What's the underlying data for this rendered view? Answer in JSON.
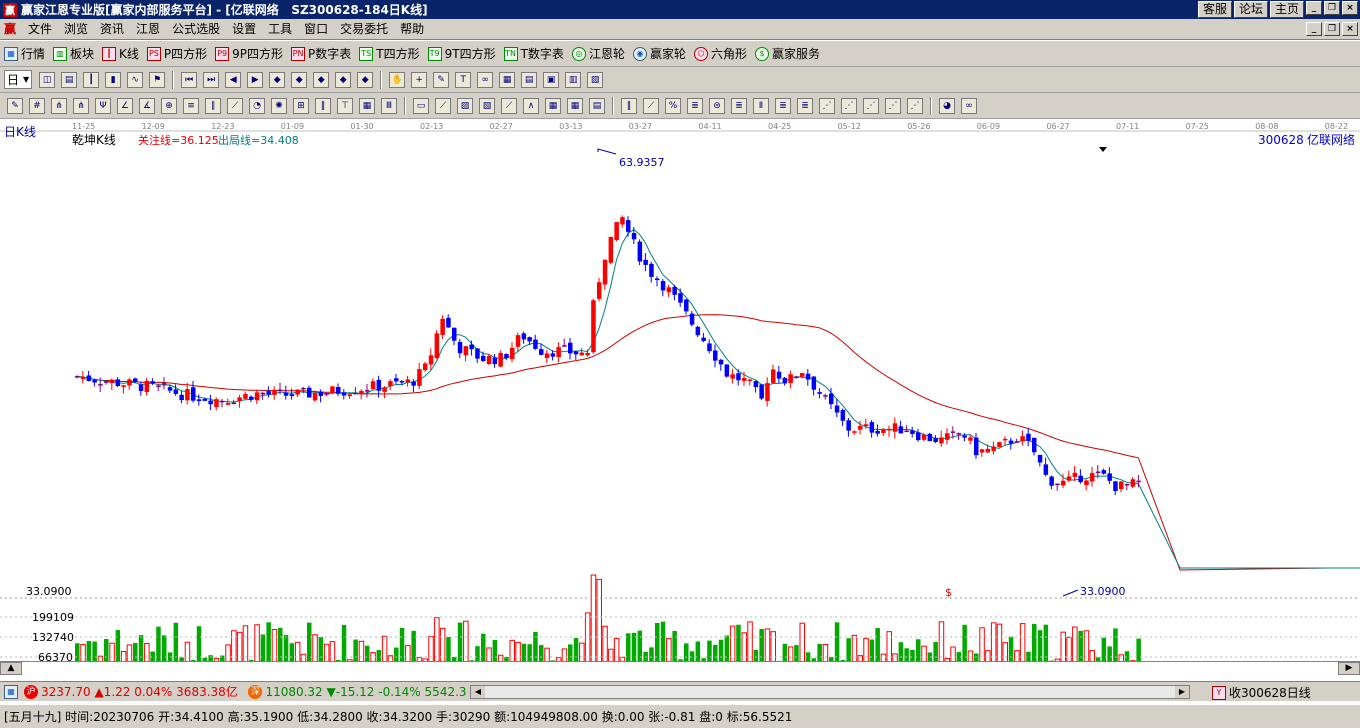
{
  "window": {
    "title": "赢家江恩专业版[赢家内部服务平台] - [亿联网络   SZ300628-184日K线]",
    "links": [
      "客服",
      "论坛",
      "主页"
    ]
  },
  "menu": [
    "文件",
    "浏览",
    "资讯",
    "江恩",
    "公式选股",
    "设置",
    "工具",
    "窗口",
    "交易委托",
    "帮助"
  ],
  "toolbar1": [
    {
      "label": "行情",
      "icon": "table-icon"
    },
    {
      "label": "板块",
      "icon": "sector-icon"
    },
    {
      "label": "K线",
      "icon": "candle-icon"
    },
    {
      "label": "P四方形",
      "icon": "ps-icon",
      "tag": "PS"
    },
    {
      "label": "9P四方形",
      "icon": "p9-icon",
      "tag": "P9"
    },
    {
      "label": "P数字表",
      "icon": "pn-icon",
      "tag": "PN"
    },
    {
      "label": "T四方形",
      "icon": "ts-icon",
      "tag": "TS"
    },
    {
      "label": "9T四方形",
      "icon": "t9-icon",
      "tag": "T9"
    },
    {
      "label": "T数字表",
      "icon": "tn-icon",
      "tag": "TN"
    },
    {
      "label": "江恩轮",
      "icon": "gann-wheel-icon"
    },
    {
      "label": "赢家轮",
      "icon": "winner-wheel-icon"
    },
    {
      "label": "六角形",
      "icon": "hexagon-icon"
    },
    {
      "label": "赢家服务",
      "icon": "service-icon"
    }
  ],
  "toolbar2": {
    "period": "日"
  },
  "chart_header": {
    "period_label": "日K线",
    "indicator_name": "乾坤K线",
    "watch_line": "关注线=36.125",
    "exit_line": "出局线=34.408",
    "stock": "300628",
    "stock_name": "亿联网络"
  },
  "chart_data": {
    "type": "candlestick",
    "date_ticks": [
      "11-25",
      "12-09",
      "12-23",
      "01-09",
      "01-30",
      "02-13",
      "02-27",
      "03-13",
      "03-27",
      "04-11",
      "04-25",
      "05-12",
      "05-26",
      "06-09",
      "06-27",
      "07-11",
      "07-25",
      "08-08",
      "08-22"
    ],
    "high_label": "63.9357",
    "low_label": "33.0900",
    "price_axis_label": "33.0900",
    "volume_axis_labels": [
      "199109",
      "132740",
      "66370"
    ],
    "marker": "$",
    "colors": {
      "up": "#ff0000",
      "down": "#0000ff",
      "neutral": "#800080",
      "ma_long": "#cc0000",
      "ma_short": "#008080",
      "vol_up": "#ff0000",
      "vol_down": "#00aa00"
    }
  },
  "status1": {
    "sh_index": "3237.70",
    "sh_change": "▲1.22 0.04%",
    "sh_amount": "3683.38亿",
    "sz_index": "11080.32",
    "sz_change": "▼-15.12 -0.14%",
    "sz_amount": "5542.3",
    "right_text": "收300628日线"
  },
  "status2": {
    "text": "[五月十九] 时间:20230706 开:34.4100 高:35.1900 低:34.2800 收:34.3200 手:30290 额:104949808.00 换:0.00 张:-0.81 盘:0 标:56.5521"
  }
}
